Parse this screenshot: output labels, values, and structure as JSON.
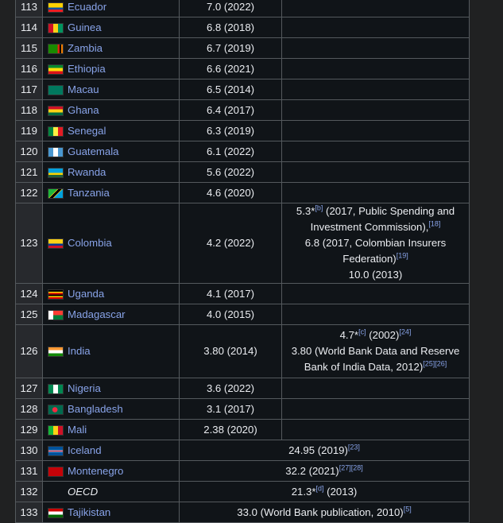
{
  "rows": [
    {
      "rank": "113",
      "country": "Ecuador",
      "flag": "linear-gradient(#ffd100 0 50%, #034ea2 50% 75%, #ed1c24 75%)",
      "v1": "7.0 (2022)"
    },
    {
      "rank": "114",
      "country": "Guinea",
      "flag": "linear-gradient(90deg,#ce1126 0 33%, #fcd116 33% 66%, #009460 66%)",
      "v1": "6.8 (2018)"
    },
    {
      "rank": "115",
      "country": "Zambia",
      "flag": "linear-gradient(90deg,#198a00 0 65%, #de2010 65% 77%, #000 77% 88%, #ef7d00 88%)",
      "v1": "6.7 (2019)"
    },
    {
      "rank": "116",
      "country": "Ethiopia",
      "flag": "linear-gradient(#078930 0 33%, #fcdd09 33% 66%, #da121a 66%)",
      "v1": "6.6 (2021)"
    },
    {
      "rank": "117",
      "country": "Macau",
      "flag": "#00785e",
      "v1": "6.5 (2014)"
    },
    {
      "rank": "118",
      "country": "Ghana",
      "flag": "linear-gradient(#ce1126 0 33%, #fcd116 33% 66%, #006b3f 66%)",
      "v1": "6.4 (2017)"
    },
    {
      "rank": "119",
      "country": "Senegal",
      "flag": "linear-gradient(90deg,#00853f 0 33%, #fdef42 33% 66%, #e31b23 66%)",
      "v1": "6.3 (2019)"
    },
    {
      "rank": "120",
      "country": "Guatemala",
      "flag": "linear-gradient(90deg,#4997d0 0 33%, #fff 33% 66%, #4997d0 66%)",
      "v1": "6.1 (2022)"
    },
    {
      "rank": "121",
      "country": "Rwanda",
      "flag": "linear-gradient(#20603d 0 0, #00a1de 0 50%, #fad201 50% 75%, #20603d 75%)",
      "v1": "5.6 (2022)"
    },
    {
      "rank": "122",
      "country": "Tanzania",
      "flag": "linear-gradient(135deg,#1eb53a 0 38%, #fcd116 38% 42%, #000 42% 58%, #fcd116 58% 62%, #00a3dd 62%)",
      "v1": "4.6 (2020)"
    }
  ],
  "colombia": {
    "rank": "123",
    "country": "Colombia",
    "v1": "4.2 (2022)",
    "flag": "linear-gradient(#fcd116 0 50%, #003893 50% 75%, #ce1126 75%)",
    "line1": "5.3*",
    "line1_sup": "[b]",
    "line1_rest": " (2017, Public Spending and",
    "line2": "Investment Commission),",
    "line2_sup": "[18]",
    "line3": "6.8 (2017, Colombian Insurers Federation)",
    "line3_sup": "[19]",
    "line4": "10.0 (2013)"
  },
  "rows2": [
    {
      "rank": "124",
      "country": "Uganda",
      "flag": "linear-gradient(#000 0 17%, #fcdc04 17% 33%, #d90000 33% 50%, #000 50% 67%, #fcdc04 67% 83%, #d90000 83%)",
      "v1": "4.1 (2017)"
    },
    {
      "rank": "125",
      "country": "Madagascar",
      "flag": "linear-gradient(90deg,#fff 0 33%, transparent 33%), linear-gradient(#fc3d32 0 50%, #007e3a 50%)",
      "v1": "4.0 (2015)"
    }
  ],
  "india": {
    "rank": "126",
    "country": "India",
    "v1": "3.80 (2014)",
    "flag": "linear-gradient(#ff9933 0 33%, #fff 33% 66%, #138808 66%)",
    "line1": "4.7*",
    "line1_sup": "[c]",
    "line1_rest": " (2002)",
    "line1_sup2": "[24]",
    "line2": "3.80 (World Bank Data and Reserve",
    "line3": "Bank of India Data, 2012)",
    "line3_sup": "[25][26]"
  },
  "rows3": [
    {
      "rank": "127",
      "country": "Nigeria",
      "flag": "linear-gradient(90deg,#008751 0 33%, #fff 33% 66%, #008751 66%)",
      "v1": "3.6 (2022)"
    },
    {
      "rank": "128",
      "country": "Bangladesh",
      "flag": "radial-gradient(circle at 45% 50%, #f42a41 0 28%, #006a4e 30%)",
      "v1": "3.1 (2017)"
    },
    {
      "rank": "129",
      "country": "Mali",
      "flag": "linear-gradient(90deg,#14b53a 0 33%, #fcd116 33% 66%, #ce1126 66%)",
      "v1": "2.38 (2020)"
    }
  ],
  "rows4": [
    {
      "rank": "130",
      "country": "Iceland",
      "flag": "linear-gradient(#02529c 0 40%, #fff 40% 44%, #dc1e35 44% 56%, #fff 56% 60%, #02529c 60%)",
      "v2": "24.95 (2019)",
      "sup": "[23]"
    },
    {
      "rank": "131",
      "country": "Montenegro",
      "flag": "#c40308",
      "v2": "32.2 (2021)",
      "sup": "[27][28]"
    }
  ],
  "oecd": {
    "rank": "132",
    "country": "OECD",
    "v2": "21.3*",
    "sup": "[d]",
    "rest": " (2013)"
  },
  "tajik": {
    "rank": "133",
    "country": "Tajikistan",
    "flag": "linear-gradient(#cc0000 0 30%, #fff 30% 70%, #006600 70%)",
    "v2": "33.0 (World Bank publication, 2010)",
    "sup": "[5]"
  }
}
